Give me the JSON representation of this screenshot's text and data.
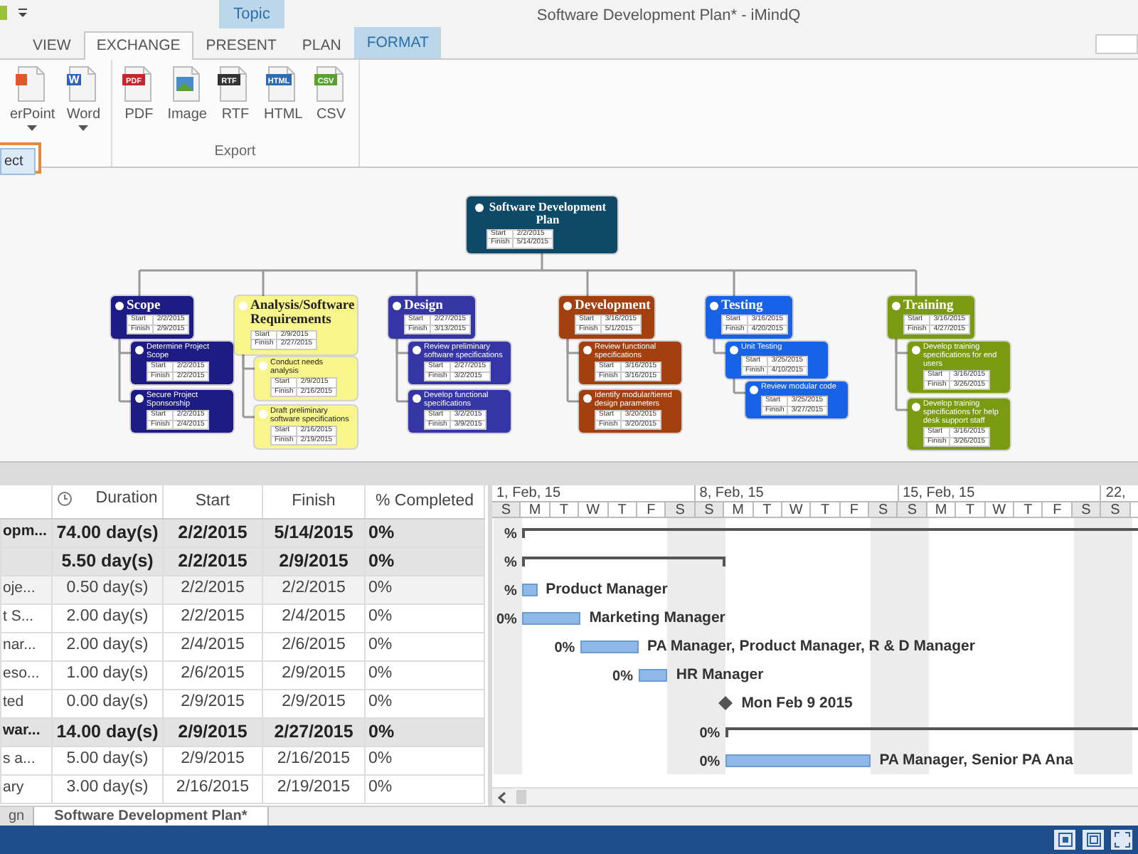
{
  "window": {
    "title": "Software Development Plan* - iMindQ"
  },
  "contextual_tab_group": {
    "label": "Topic"
  },
  "ribbon_tabs": [
    {
      "label": "VIEW",
      "selected": false,
      "kind": "normal"
    },
    {
      "label": "EXCHANGE",
      "selected": true,
      "kind": "normal"
    },
    {
      "label": "PRESENT",
      "selected": false,
      "kind": "normal"
    },
    {
      "label": "PLAN",
      "selected": false,
      "kind": "normal"
    },
    {
      "label": "FORMAT",
      "selected": false,
      "kind": "contextual"
    }
  ],
  "ribbon_groups": [
    {
      "buttons": [
        {
          "label": "erPoint",
          "kind": "powerpoint",
          "dropdown": true
        },
        {
          "label": "Word",
          "kind": "word",
          "icon_text": "W",
          "dropdown": true
        }
      ]
    },
    {
      "label": "Export",
      "buttons": [
        {
          "label": "PDF",
          "kind": "pdf",
          "icon_text": "PDF",
          "dropdown": false
        },
        {
          "label": "Image",
          "kind": "image",
          "dropdown": false
        },
        {
          "label": "RTF",
          "kind": "rtf",
          "icon_text": "RTF",
          "dropdown": false
        },
        {
          "label": "HTML",
          "kind": "html",
          "icon_text": "HTML",
          "dropdown": false
        },
        {
          "label": "CSV",
          "kind": "csv",
          "icon_text": "CSV",
          "dropdown": false
        }
      ]
    }
  ],
  "open_menu": {
    "items": [
      {
        "label": "ect",
        "selected": true
      }
    ]
  },
  "mind_map": {
    "root": {
      "title": "Software Development Plan",
      "start_label": "Start",
      "start": "2/2/2015",
      "finish_label": "Finish",
      "finish": "5/14/2015",
      "color": "#0e4a68",
      "children": [
        {
          "title": "Scope",
          "start_label": "Start",
          "start": "2/2/2015",
          "finish_label": "Finish",
          "finish": "2/9/2015",
          "color": "#1c1c84",
          "children": [
            {
              "title": "Determine Project Scope",
              "start_label": "Start",
              "start": "2/2/2015",
              "finish_label": "Finish",
              "finish": "2/2/2015",
              "color": "#1c1c84"
            },
            {
              "title": "Secure Project Sponsorship",
              "start_label": "Start",
              "start": "2/2/2015",
              "finish_label": "Finish",
              "finish": "2/4/2015",
              "color": "#1c1c84"
            }
          ]
        },
        {
          "title": "Analysis/Software Requirements",
          "start_label": "Start",
          "start": "2/9/2015",
          "finish_label": "Finish",
          "finish": "2/27/2015",
          "color": "#f8f58c",
          "children": [
            {
              "title": "Conduct needs analysis",
              "start_label": "Start",
              "start": "2/9/2015",
              "finish_label": "Finish",
              "finish": "2/16/2015",
              "color": "#f8f58c"
            },
            {
              "title": "Draft preliminary software specifications",
              "start_label": "Start",
              "start": "2/16/2015",
              "finish_label": "Finish",
              "finish": "2/19/2015",
              "color": "#f8f58c"
            }
          ]
        },
        {
          "title": "Design",
          "start_label": "Start",
          "start": "2/27/2015",
          "finish_label": "Finish",
          "finish": "3/13/2015",
          "color": "#3535a6",
          "children": [
            {
              "title": "Review preliminary software specifications",
              "start_label": "Start",
              "start": "2/27/2015",
              "finish_label": "Finish",
              "finish": "3/2/2015",
              "color": "#3535a6"
            },
            {
              "title": "Develop functional specifications",
              "start_label": "Start",
              "start": "3/2/2015",
              "finish_label": "Finish",
              "finish": "3/9/2015",
              "color": "#3535a6"
            }
          ]
        },
        {
          "title": "Development",
          "start_label": "Start",
          "start": "3/16/2015",
          "finish_label": "Finish",
          "finish": "5/1/2015",
          "color": "#a3400f",
          "children": [
            {
              "title": "Review functional specifications",
              "start_label": "Start",
              "start": "3/16/2015",
              "finish_label": "Finish",
              "finish": "3/16/2015",
              "color": "#a3400f"
            },
            {
              "title": "Identify modular/tiered design parameters",
              "start_label": "Start",
              "start": "3/20/2015",
              "finish_label": "Finish",
              "finish": "3/20/2015",
              "color": "#a3400f"
            }
          ]
        },
        {
          "title": "Testing",
          "start_label": "Start",
          "start": "3/16/2015",
          "finish_label": "Finish",
          "finish": "4/20/2015",
          "color": "#1762e6",
          "children": [
            {
              "title": "Unit Testing",
              "start_label": "Start",
              "start": "3/25/2015",
              "finish_label": "Finish",
              "finish": "4/10/2015",
              "color": "#1762e6",
              "children": [
                {
                  "title": "Review modular code",
                  "start_label": "Start",
                  "start": "3/25/2015",
                  "finish_label": "Finish",
                  "finish": "3/27/2015",
                  "color": "#1762e6"
                }
              ]
            }
          ]
        },
        {
          "title": "Training",
          "start_label": "Start",
          "start": "3/16/2015",
          "finish_label": "Finish",
          "finish": "4/27/2015",
          "color": "#7a9a12",
          "children": [
            {
              "title": "Develop training specifications for end users",
              "start_label": "Start",
              "start": "3/16/2015",
              "finish_label": "Finish",
              "finish": "3/26/2015",
              "color": "#7a9a12"
            },
            {
              "title": "Develop training specifications for help desk support staff",
              "start_label": "Start",
              "start": "3/16/2015",
              "finish_label": "Finish",
              "finish": "3/26/2015",
              "color": "#7a9a12"
            }
          ]
        }
      ]
    }
  },
  "task_table": {
    "columns": [
      "Duration",
      "Start",
      "Finish",
      "% Completed"
    ],
    "rows": [
      {
        "name": "opm...",
        "duration": "74.00 day(s)",
        "start": "2/2/2015",
        "finish": "5/14/2015",
        "completed": "0%",
        "kind": "summary",
        "selected": false
      },
      {
        "duration": "5.50 day(s)",
        "start": "2/2/2015",
        "finish": "2/9/2015",
        "completed": "0%",
        "kind": "summary",
        "selected": false
      },
      {
        "name": "oje...",
        "duration": "0.50 day(s)",
        "start": "2/2/2015",
        "finish": "2/2/2015",
        "completed": "0%",
        "kind": "task",
        "selected": true
      },
      {
        "name": "t  S...",
        "duration": "2.00 day(s)",
        "start": "2/2/2015",
        "finish": "2/4/2015",
        "completed": "0%",
        "kind": "task",
        "selected": false
      },
      {
        "name": "nar...",
        "duration": "2.00 day(s)",
        "start": "2/4/2015",
        "finish": "2/6/2015",
        "completed": "0%",
        "kind": "task",
        "selected": false
      },
      {
        "name": "eso...",
        "duration": "1.00 day(s)",
        "start": "2/6/2015",
        "finish": "2/9/2015",
        "completed": "0%",
        "kind": "task",
        "selected": false
      },
      {
        "name": "ted",
        "duration": "0.00 day(s)",
        "start": "2/9/2015",
        "finish": "2/9/2015",
        "completed": "0%",
        "kind": "task",
        "selected": false
      },
      {
        "name": "war...",
        "duration": "14.00 day(s)",
        "start": "2/9/2015",
        "finish": "2/27/2015",
        "completed": "0%",
        "kind": "summary",
        "selected": false
      },
      {
        "name": "s a...",
        "duration": "5.00 day(s)",
        "start": "2/9/2015",
        "finish": "2/16/2015",
        "completed": "0%",
        "kind": "task",
        "selected": false
      },
      {
        "name": "ary",
        "duration": "3.00 day(s)",
        "start": "2/16/2015",
        "finish": "2/19/2015",
        "completed": "0%",
        "kind": "task",
        "selected": false
      }
    ]
  },
  "gantt": {
    "weeks": [
      "1, Feb, 15",
      "8, Feb, 15",
      "15, Feb, 15",
      "22,"
    ],
    "days": [
      {
        "label": "S",
        "weekend": true
      },
      {
        "label": "M",
        "weekend": false
      },
      {
        "label": "T",
        "weekend": false
      },
      {
        "label": "W",
        "weekend": false
      },
      {
        "label": "T",
        "weekend": false
      },
      {
        "label": "F",
        "weekend": false
      },
      {
        "label": "S",
        "weekend": true
      },
      {
        "label": "S",
        "weekend": true
      },
      {
        "label": "M",
        "weekend": false
      },
      {
        "label": "T",
        "weekend": false
      },
      {
        "label": "W",
        "weekend": false
      },
      {
        "label": "T",
        "weekend": false
      },
      {
        "label": "F",
        "weekend": false
      },
      {
        "label": "S",
        "weekend": true
      },
      {
        "label": "S",
        "weekend": true
      },
      {
        "label": "M",
        "weekend": false
      },
      {
        "label": "T",
        "weekend": false
      },
      {
        "label": "W",
        "weekend": false
      },
      {
        "label": "T",
        "weekend": false
      },
      {
        "label": "F",
        "weekend": false
      },
      {
        "label": "S",
        "weekend": true
      },
      {
        "label": "S",
        "weekend": true
      }
    ],
    "rows": [
      {
        "kind": "summary",
        "percent": "%"
      },
      {
        "kind": "summary",
        "percent": "%"
      },
      {
        "kind": "task",
        "percent": "%",
        "resource": "Product Manager"
      },
      {
        "kind": "task",
        "percent": "0%",
        "resource": "Marketing Manager"
      },
      {
        "kind": "task",
        "percent": "0%",
        "resource": "PA Manager, Product Manager, R & D Manager"
      },
      {
        "kind": "task",
        "percent": "0%",
        "resource": "HR Manager"
      },
      {
        "kind": "milestone",
        "resource": "Mon Feb 9 2015"
      },
      {
        "kind": "summary",
        "percent": "0%"
      },
      {
        "kind": "task",
        "percent": "0%",
        "resource": "PA Manager, Senior PA Ana"
      }
    ]
  },
  "document_tabs": [
    {
      "label": "gn",
      "selected": false
    },
    {
      "label": "Software Development Plan*",
      "selected": true
    }
  ]
}
